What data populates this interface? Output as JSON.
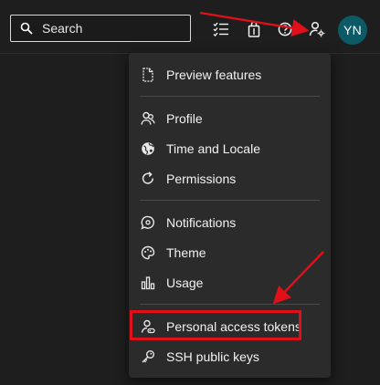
{
  "header": {
    "search": {
      "placeholder": "Search"
    },
    "icons": [
      "task-list-icon",
      "marketplace-bag-icon",
      "help-icon",
      "user-settings-icon"
    ],
    "avatar_initials": "YN",
    "avatar_color": "#0c5a66"
  },
  "menu": {
    "groups": [
      {
        "items": [
          {
            "label": "Preview features",
            "icon": "document-icon"
          }
        ]
      },
      {
        "items": [
          {
            "label": "Profile",
            "icon": "profile-icon"
          },
          {
            "label": "Time and Locale",
            "icon": "globe-icon"
          },
          {
            "label": "Permissions",
            "icon": "refresh-icon"
          }
        ]
      },
      {
        "items": [
          {
            "label": "Notifications",
            "icon": "chat-bubble-icon"
          },
          {
            "label": "Theme",
            "icon": "palette-icon"
          },
          {
            "label": "Usage",
            "icon": "bar-chart-icon"
          }
        ]
      },
      {
        "items": [
          {
            "label": "Personal access tokens",
            "icon": "token-user-icon"
          },
          {
            "label": "SSH public keys",
            "icon": "key-icon"
          }
        ]
      }
    ]
  },
  "annotations": {
    "highlight_color": "#e0101a",
    "highlighted_item": "Personal access tokens"
  }
}
